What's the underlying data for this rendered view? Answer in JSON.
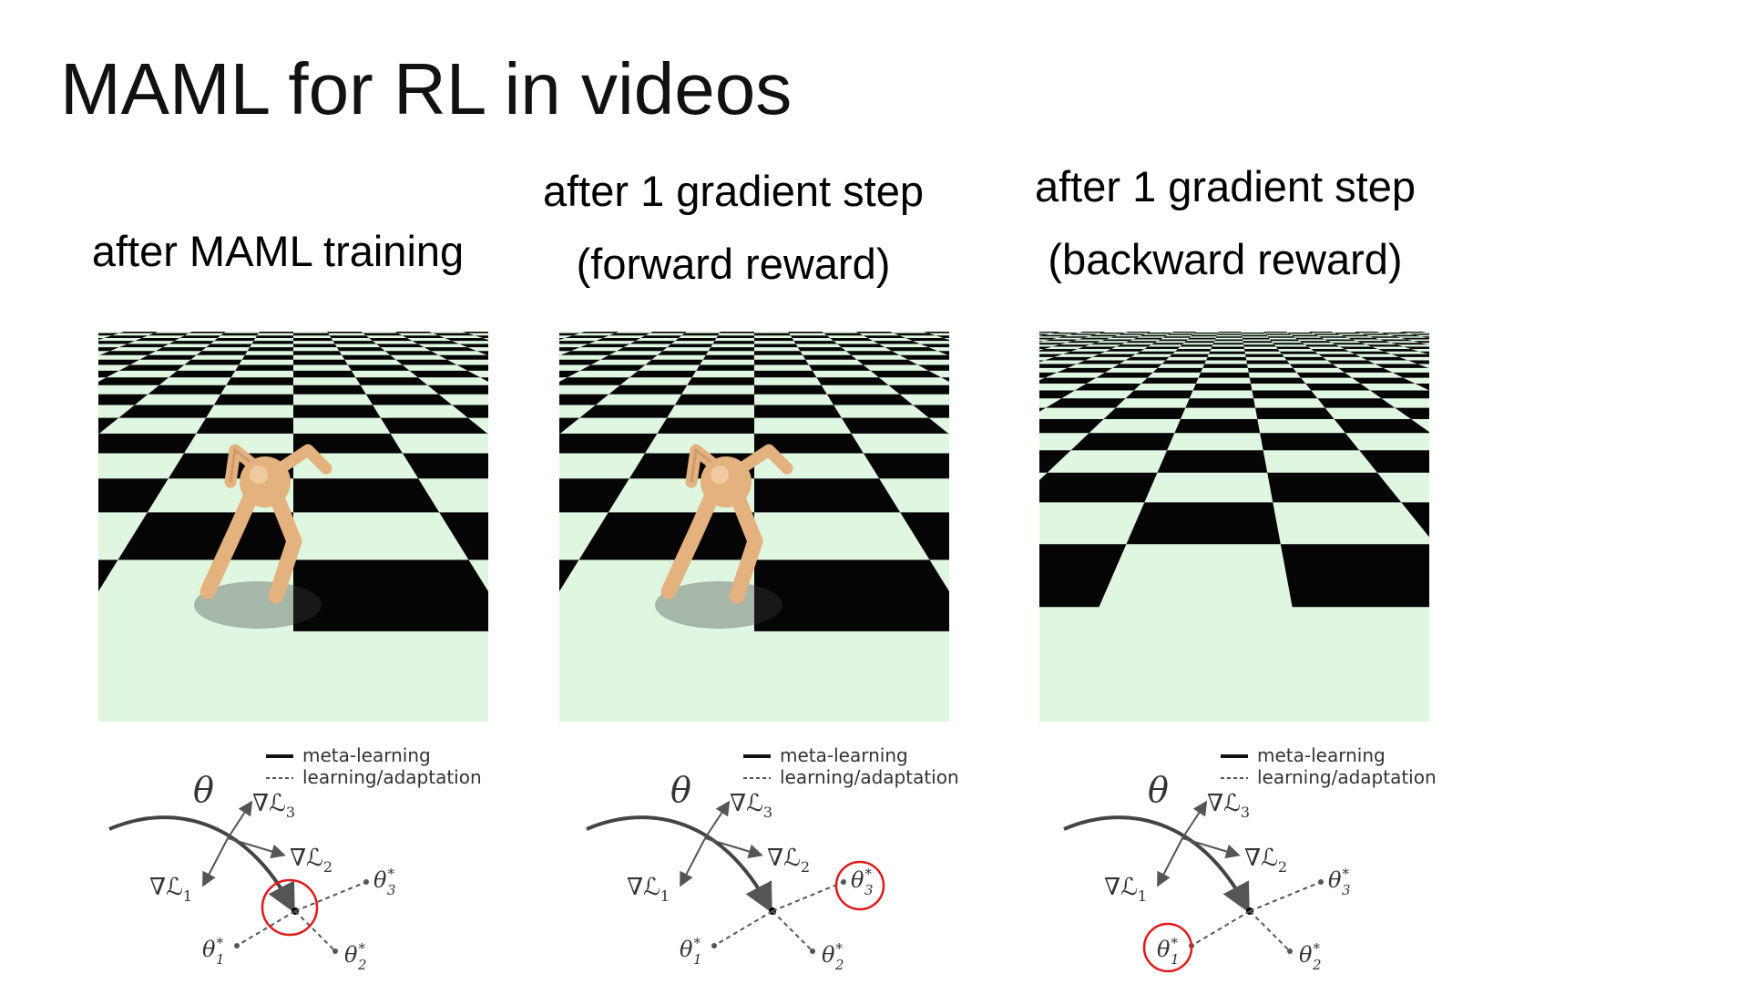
{
  "slide": {
    "title": "MAML for RL in videos"
  },
  "panels": [
    {
      "caption": [
        "after MAML training"
      ],
      "has_ant": true,
      "highlight": "center"
    },
    {
      "caption": [
        "after 1 gradient step",
        "(forward reward)"
      ],
      "has_ant": true,
      "highlight": "theta3"
    },
    {
      "caption": [
        "after 1 gradient step",
        "(backward reward)"
      ],
      "has_ant": false,
      "highlight": "theta1"
    }
  ],
  "diagram": {
    "legend_solid": "meta-learning",
    "legend_dashed": "learning/adaptation",
    "theta": "θ",
    "grad_L1": "∇ℒ",
    "grad_L2": "∇ℒ",
    "grad_L3": "∇ℒ",
    "theta_star": "θ",
    "sub1": "1",
    "sub2": "2",
    "sub3": "3",
    "star": "*"
  },
  "colors": {
    "checker_light": "#dff7e1",
    "checker_dark": "#050505",
    "ant_body": "#e3b27f",
    "highlight_circle": "#e01b1b",
    "diagram_line": "#444444"
  }
}
